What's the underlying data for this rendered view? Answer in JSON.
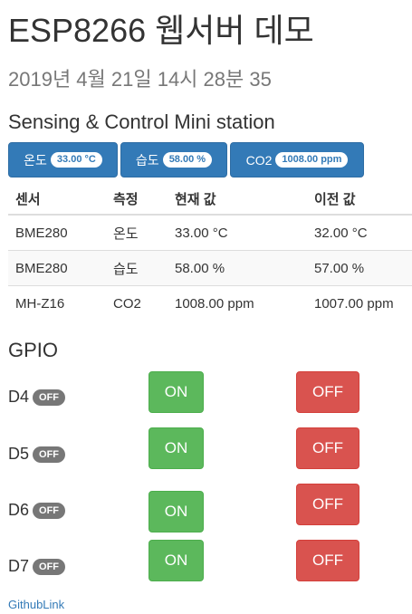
{
  "header": {
    "title": "ESP8266 웹서버 데모",
    "datetime": "2019년 4월 21일 14시 28분 35",
    "station_title": "Sensing & Control Mini station"
  },
  "summary_buttons": [
    {
      "label": "온도",
      "value": "33.00 °C"
    },
    {
      "label": "습도",
      "value": "58.00 %"
    },
    {
      "label": "CO2",
      "value": "1008.00 ppm"
    }
  ],
  "table": {
    "headers": [
      "센서",
      "측정",
      "현재 값",
      "이전 값"
    ],
    "rows": [
      [
        "BME280",
        "온도",
        "33.00 °C",
        "32.00 °C"
      ],
      [
        "BME280",
        "습도",
        "58.00 %",
        "57.00 %"
      ],
      [
        "MH-Z16",
        "CO2",
        "1008.00 ppm",
        "1007.00 ppm"
      ]
    ]
  },
  "gpio": {
    "title": "GPIO",
    "pins": [
      {
        "name": "D4",
        "state": "OFF",
        "on_label": "ON",
        "off_label": "OFF"
      },
      {
        "name": "D5",
        "state": "OFF",
        "on_label": "ON",
        "off_label": "OFF"
      },
      {
        "name": "D6",
        "state": "OFF",
        "on_label": "ON",
        "off_label": "OFF"
      },
      {
        "name": "D7",
        "state": "OFF",
        "on_label": "ON",
        "off_label": "OFF"
      }
    ]
  },
  "footer": {
    "link_text": "GithubLink"
  },
  "colors": {
    "primary": "#337ab7",
    "success": "#5cb85c",
    "danger": "#d9534f",
    "badge": "#777777"
  }
}
